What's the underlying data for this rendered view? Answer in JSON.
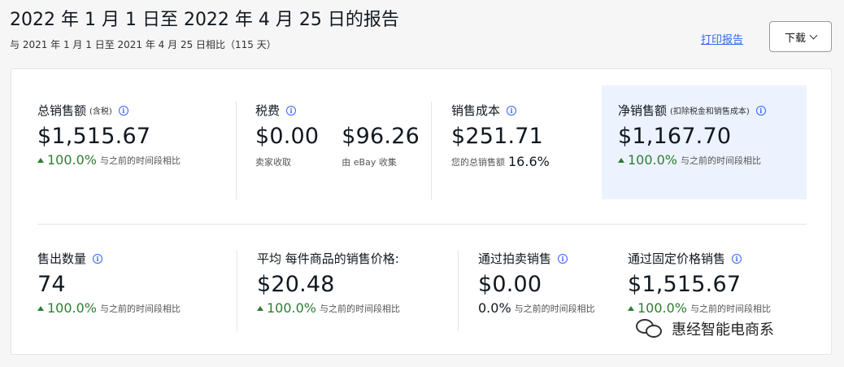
{
  "header": {
    "title": "2022 年 1 月 1 日至 2022 年 4 月 25 日的报告",
    "subtitle": "与 2021 年 1 月 1 日至 2021 年 4 月 25 日相比（115 天）",
    "print_label": "打印报告",
    "download_label": "下载"
  },
  "row1": {
    "total_sales": {
      "label": "总销售额",
      "label_small": "(含税)",
      "value": "$1,515.67",
      "change": "100.0%",
      "compare": "与之前的时间段相比"
    },
    "tax": {
      "label": "税费",
      "seller_value": "$0.00",
      "seller_caption": "卖家收取",
      "ebay_value": "$96.26",
      "ebay_caption": "由 eBay 收集"
    },
    "cost_of_sales": {
      "label": "销售成本",
      "value": "$251.71",
      "caption": "您的总销售额",
      "caption_pct": "16.6%"
    },
    "net_sales": {
      "label": "净销售额",
      "label_small": "(扣除税金和销售成本)",
      "value": "$1,167.70",
      "change": "100.0%",
      "compare": "与之前的时间段相比"
    }
  },
  "row2": {
    "items_sold": {
      "label": "售出数量",
      "value": "74",
      "change": "100.0%",
      "compare": "与之前的时间段相比"
    },
    "avg_price": {
      "label": "平均 每件商品的销售价格:",
      "value": "$20.48",
      "change": "100.0%",
      "compare": "与之前的时间段相比"
    },
    "auction_sales": {
      "label": "通过拍卖销售",
      "value": "$0.00",
      "change": "0.0%",
      "compare": "与之前的时间段相比"
    },
    "fixed_price_sales": {
      "label": "通过固定价格销售",
      "value": "$1,515.67",
      "change": "100.0%",
      "compare": "与之前的时间段相比"
    }
  },
  "watermark": {
    "text": "惠经智能电商系"
  },
  "colors": {
    "accent": "#3665f3",
    "positive": "#2e7d32",
    "highlight_bg": "#edf3fe"
  },
  "icons": {
    "info": "info-icon",
    "up": "up-arrow-icon",
    "chevron": "chevron-down-icon"
  }
}
